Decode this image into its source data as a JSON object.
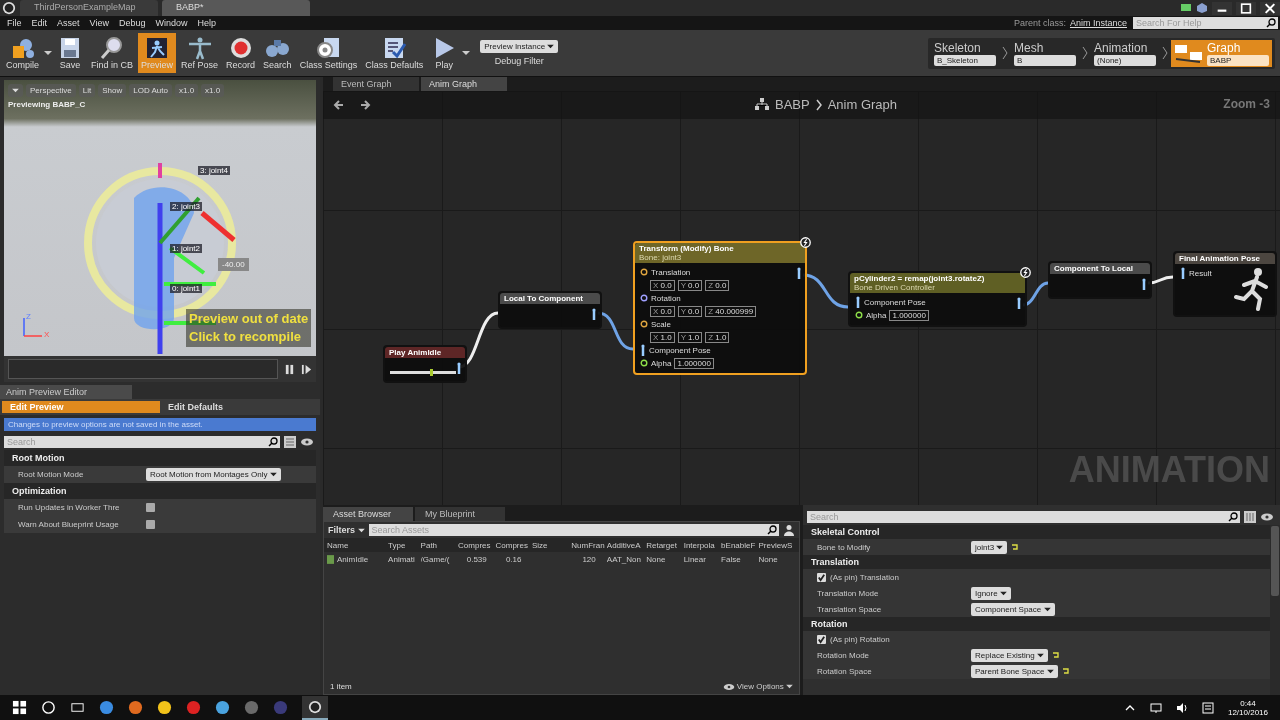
{
  "title_bar": {
    "tabs": [
      {
        "label": "ThirdPersonExampleMap",
        "selected": false
      },
      {
        "label": "BABP*",
        "selected": true
      }
    ]
  },
  "menu": [
    "File",
    "Edit",
    "Asset",
    "View",
    "Debug",
    "Window",
    "Help"
  ],
  "parent_class": {
    "label": "Parent class:",
    "value": "Anim Instance"
  },
  "help_search": {
    "placeholder": "Search For Help"
  },
  "toolbar": {
    "buttons": [
      {
        "label": "Compile",
        "kind": "compile",
        "selected": false
      },
      {
        "label": "Save",
        "kind": "save",
        "selected": false
      },
      {
        "label": "Find in CB",
        "kind": "find",
        "selected": false
      },
      {
        "label": "Preview",
        "kind": "preview",
        "selected": true
      },
      {
        "label": "Ref Pose",
        "kind": "refpose",
        "selected": false
      },
      {
        "label": "Record",
        "kind": "record",
        "selected": false
      },
      {
        "label": "Search",
        "kind": "search",
        "selected": false
      },
      {
        "label": "Class Settings",
        "kind": "settings",
        "selected": false
      },
      {
        "label": "Class Defaults",
        "kind": "defaults",
        "selected": false
      },
      {
        "label": "Play",
        "kind": "play",
        "selected": false
      }
    ],
    "debug_filter": {
      "value": "Preview Instance",
      "label": "Debug Filter"
    }
  },
  "modes": [
    {
      "label": "Skeleton",
      "value": "B_Skeleton",
      "selected": false
    },
    {
      "label": "Mesh",
      "value": "B",
      "selected": false
    },
    {
      "label": "Animation",
      "value": "(None)",
      "selected": false
    },
    {
      "label": "Graph",
      "value": "BABP",
      "selected": true
    }
  ],
  "viewport": {
    "buttons": [
      "Perspective",
      "Lit",
      "Show",
      "LOD Auto",
      "x1.0",
      "x1.0"
    ],
    "caption": "Previewing BABP_C",
    "bones": [
      "3: joint4",
      "2: joint3",
      "1: joint2",
      "0: joint1"
    ],
    "readout": "-40.00",
    "warning": [
      "Preview out of date",
      "Click to recompile"
    ],
    "axes": [
      "Z",
      "X"
    ]
  },
  "preview_editor": {
    "tab": "Anim Preview Editor",
    "modes": [
      {
        "label": "Edit Preview",
        "selected": true
      },
      {
        "label": "Edit Defaults",
        "selected": false
      }
    ],
    "notice": "Changes to preview options are not saved in the asset.",
    "search": {
      "placeholder": "Search"
    },
    "sections": [
      {
        "title": "Root Motion",
        "rows": [
          {
            "kind": "dropdown",
            "label": "Root Motion Mode",
            "value": "Root Motion from Montages Only"
          }
        ]
      },
      {
        "title": "Optimization",
        "rows": [
          {
            "kind": "checkbox",
            "label": "Run Updates in Worker Thre",
            "checked": false
          },
          {
            "kind": "checkbox",
            "label": "Warn About Blueprint Usage",
            "checked": false
          }
        ]
      }
    ]
  },
  "graph": {
    "tabs": [
      {
        "label": "Event Graph",
        "selected": false
      },
      {
        "label": "Anim Graph",
        "selected": true
      }
    ],
    "breadcrumb": [
      "BABP",
      "Anim Graph"
    ],
    "zoom": "Zoom -3",
    "watermark": "ANIMATION",
    "nodes": [
      {
        "kind": "play",
        "title": "Play AnimIdle",
        "selected": false,
        "badge": false
      },
      {
        "kind": "convert",
        "title": "Local To Component",
        "selected": false,
        "badge": false
      },
      {
        "kind": "control",
        "title": "Transform (Modify) Bone",
        "subtitle": "Bone: joint3",
        "selected": true,
        "badge": true,
        "rows": [
          {
            "kind": "vector",
            "label": "Translation",
            "fields": [
              {
                "axis": "X",
                "value": "0.0"
              },
              {
                "axis": "Y",
                "value": "0.0"
              },
              {
                "axis": "Z",
                "value": "0.0"
              }
            ]
          },
          {
            "kind": "rotator",
            "label": "Rotation",
            "fields": [
              {
                "axis": "X",
                "value": "0.0"
              },
              {
                "axis": "Y",
                "value": "0.0"
              },
              {
                "axis": "Z",
                "value": "40.000999"
              }
            ]
          },
          {
            "kind": "vector",
            "label": "Scale",
            "fields": [
              {
                "axis": "X",
                "value": "1.0"
              },
              {
                "axis": "Y",
                "value": "1.0"
              },
              {
                "axis": "Z",
                "value": "1.0"
              }
            ]
          },
          {
            "kind": "pose",
            "label": "Component Pose"
          },
          {
            "kind": "float",
            "label": "Alpha",
            "value": "1.000000"
          }
        ]
      },
      {
        "kind": "driver",
        "title": "pCylinder2 = remap(joint3.rotateZ)",
        "subtitle": "Bone Driven Controller",
        "selected": false,
        "badge": true,
        "rows": [
          {
            "kind": "pose",
            "label": "Component Pose"
          },
          {
            "kind": "float",
            "label": "Alpha",
            "value": "1.000000"
          }
        ]
      },
      {
        "kind": "convert",
        "title": "Component To Local",
        "selected": false,
        "badge": false
      },
      {
        "kind": "result",
        "title": "Final Animation Pose",
        "selected": false,
        "badge": false,
        "rows": [
          {
            "kind": "pose",
            "label": "Result"
          }
        ]
      }
    ]
  },
  "asset_browser": {
    "tabs": [
      {
        "label": "Asset Browser",
        "selected": true
      },
      {
        "label": "My Blueprint",
        "selected": false
      }
    ],
    "filters": "Filters",
    "search": {
      "placeholder": "Search Assets"
    },
    "columns": [
      "Name",
      "Type",
      "Path",
      "Compres",
      "Compres",
      "Size",
      "NumFran",
      "AdditiveA",
      "Retarget",
      "Interpola",
      "bEnableF",
      "PreviewS"
    ],
    "rows": [
      [
        "AnimIdle",
        "Animati",
        "/Game/(",
        "0.539",
        "0.16",
        null,
        "120",
        "AAT_Non",
        "None",
        "Linear",
        "False",
        "None"
      ]
    ],
    "count": "1 item",
    "view_options": "View Options"
  },
  "details": {
    "search": {
      "placeholder": "Search"
    },
    "sections": [
      {
        "title": "Skeletal Control",
        "rows": [
          {
            "kind": "dropdown",
            "label": "Bone to Modify",
            "value": "joint3",
            "reset": true
          }
        ]
      },
      {
        "title": "Translation",
        "rows": [
          {
            "kind": "pin",
            "label": "(As pin) Translation",
            "checked": true
          },
          {
            "kind": "dropdown",
            "label": "Translation Mode",
            "value": "Ignore",
            "reset": false
          },
          {
            "kind": "dropdown",
            "label": "Translation Space",
            "value": "Component Space",
            "reset": false
          }
        ]
      },
      {
        "title": "Rotation",
        "rows": [
          {
            "kind": "pin",
            "label": "(As pin) Rotation",
            "checked": true
          },
          {
            "kind": "dropdown",
            "label": "Rotation Mode",
            "value": "Replace Existing",
            "reset": true
          },
          {
            "kind": "dropdown",
            "label": "Rotation Space",
            "value": "Parent Bone Space",
            "reset": true
          }
        ]
      }
    ]
  },
  "taskbar": {
    "time": "0:44",
    "date": "12/10/2016"
  }
}
